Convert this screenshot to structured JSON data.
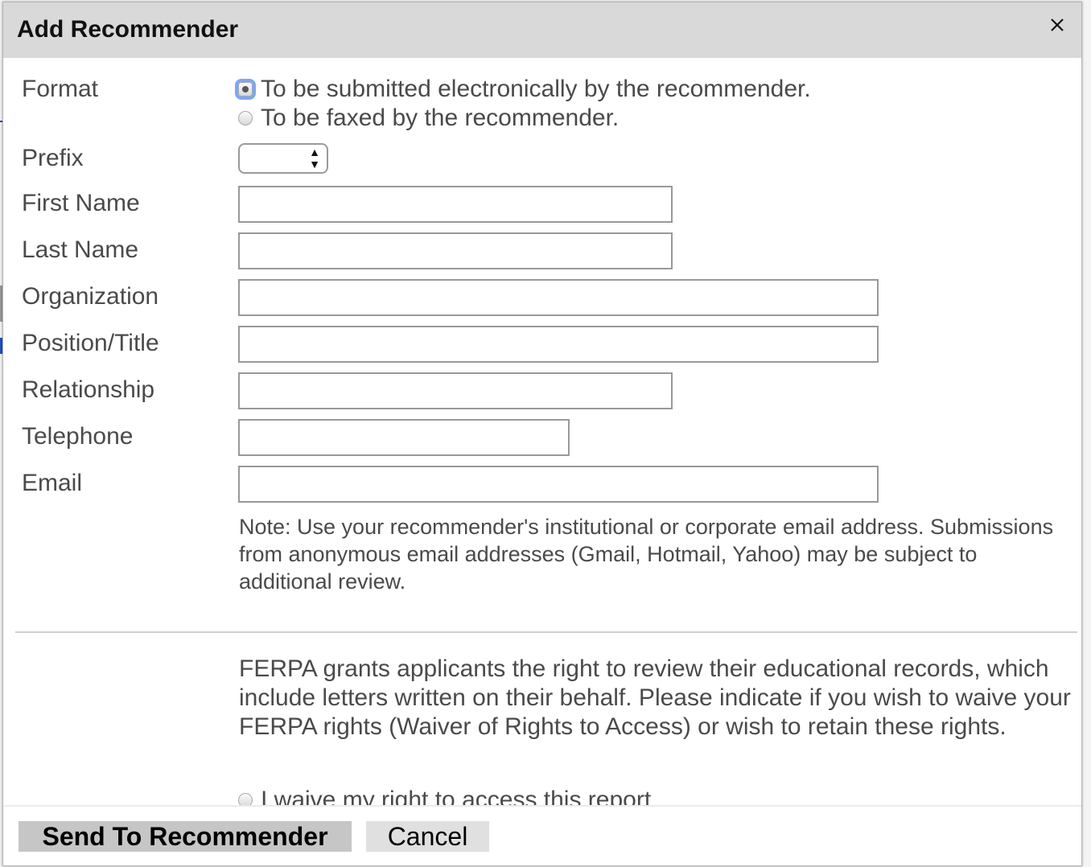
{
  "dialog": {
    "title": "Add Recommender",
    "close_icon": "close-icon"
  },
  "form": {
    "format": {
      "label": "Format",
      "options": [
        {
          "label": "To be submitted electronically by the recommender.",
          "checked": true
        },
        {
          "label": "To be faxed by the recommender.",
          "checked": false
        }
      ]
    },
    "prefix": {
      "label": "Prefix",
      "value": ""
    },
    "first_name": {
      "label": "First Name",
      "value": ""
    },
    "last_name": {
      "label": "Last Name",
      "value": ""
    },
    "organization": {
      "label": "Organization",
      "value": ""
    },
    "position_title": {
      "label": "Position/Title",
      "value": ""
    },
    "relationship": {
      "label": "Relationship",
      "value": ""
    },
    "telephone": {
      "label": "Telephone",
      "value": ""
    },
    "email": {
      "label": "Email",
      "value": ""
    },
    "email_note": "Note: Use your recommender's institutional or corporate email address. Submissions from anonymous email addresses (Gmail, Hotmail, Yahoo) may be subject to additional review.",
    "ferpa_text": "FERPA grants applicants the right to review their educational records, which include letters written on their behalf. Please indicate if you wish to waive your FERPA rights (Waiver of Rights to Access) or wish to retain these rights.",
    "ferpa_options": [
      {
        "label": "I waive my right to access this report",
        "checked": false
      }
    ]
  },
  "footer": {
    "send_label": "Send To Recommender",
    "cancel_label": "Cancel"
  }
}
